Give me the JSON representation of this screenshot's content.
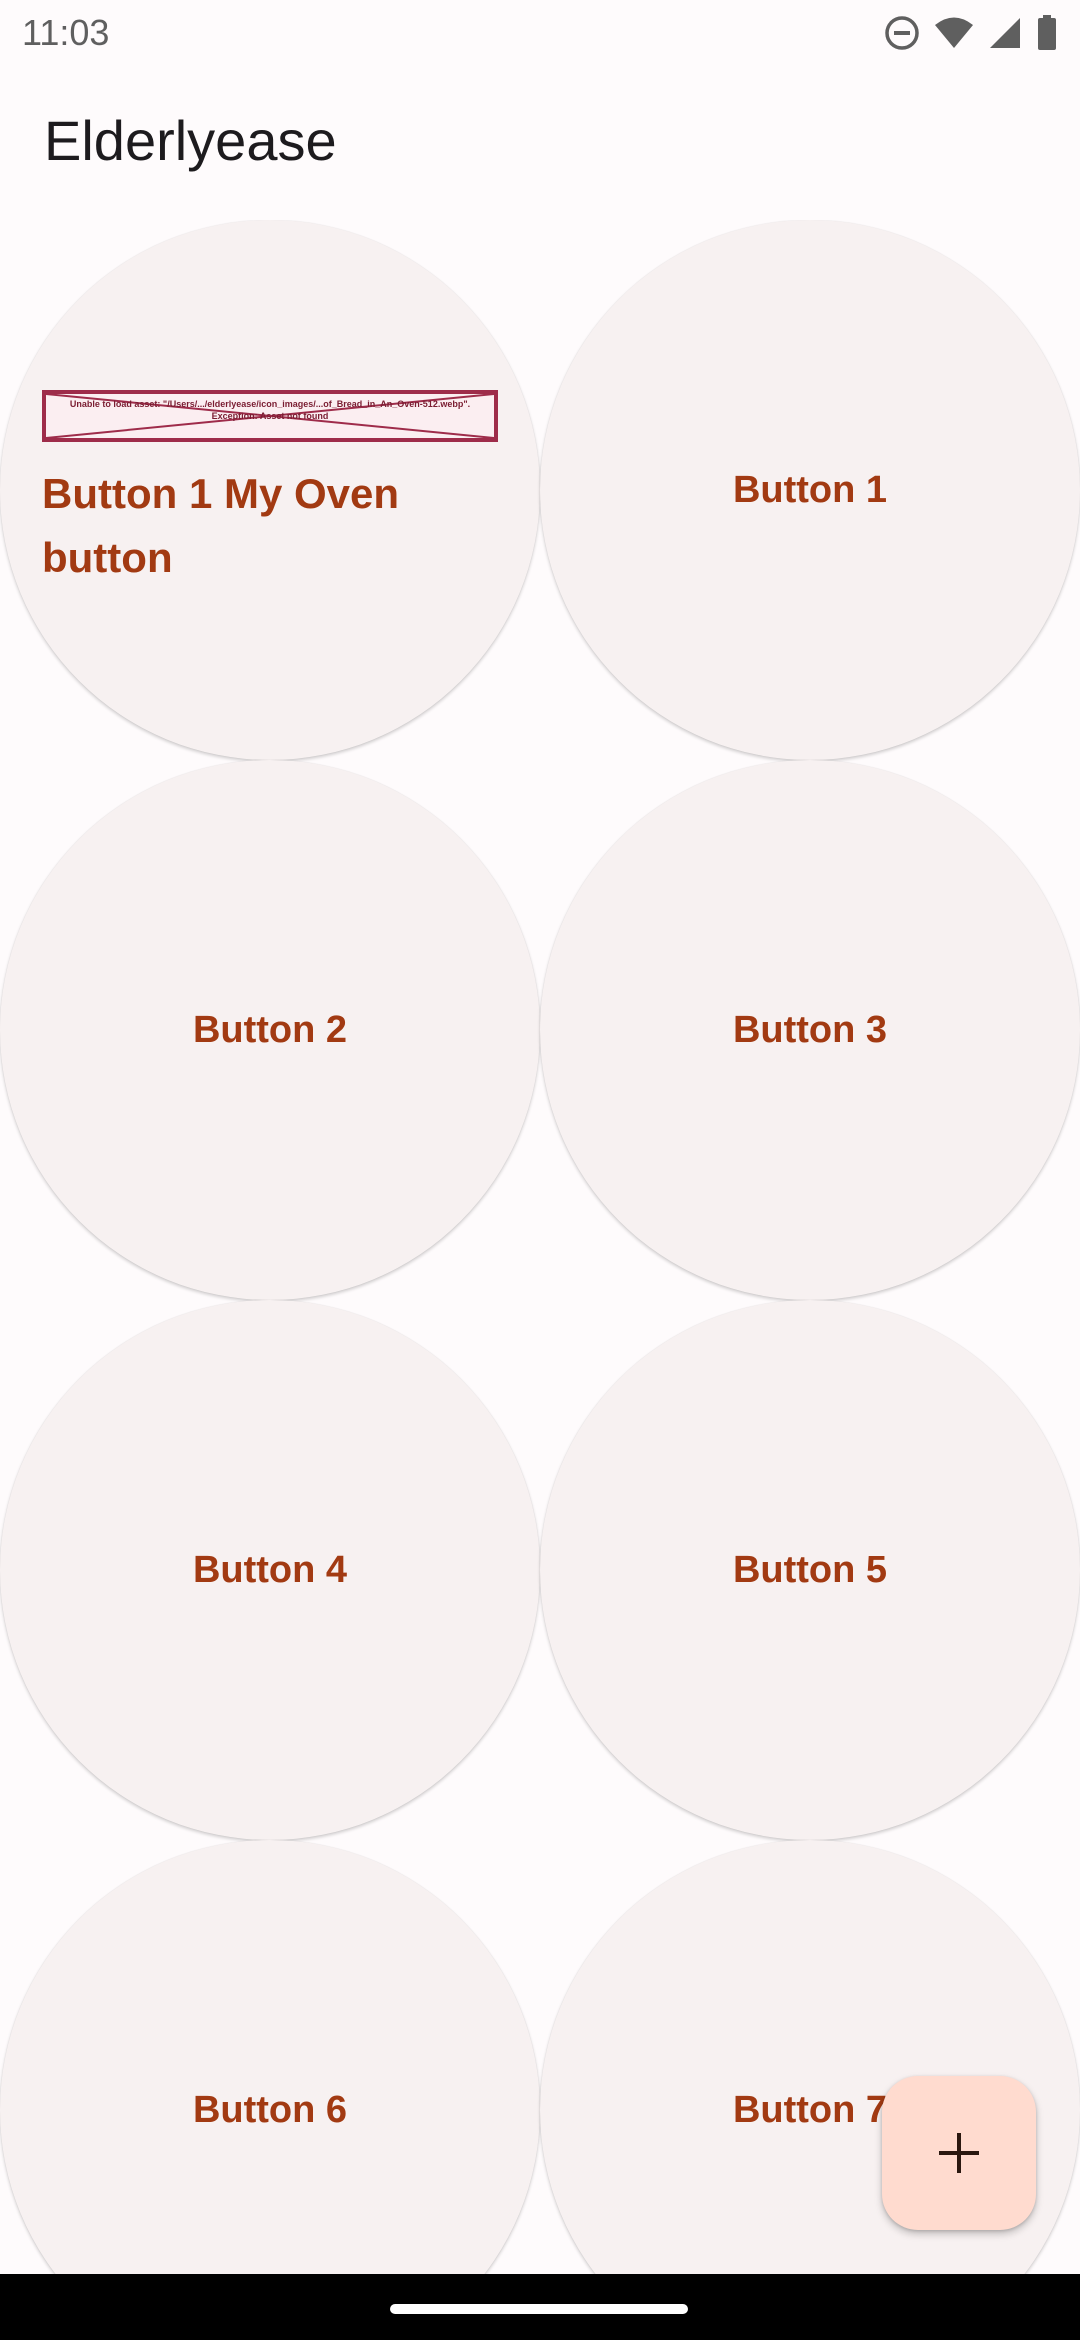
{
  "status_bar": {
    "time": "11:03",
    "icons": [
      "do-not-disturb-icon",
      "wifi-icon",
      "cell-signal-icon",
      "battery-icon"
    ]
  },
  "app_bar": {
    "title": "Elderlyease"
  },
  "buttons": [
    {
      "label": "Button 1 My Oven button",
      "image_error": "Unable to load asset: \"/Users/.../elderlyease/icon_images/...of_Bread_in_An_Oven-512.webp\". Exception: Asset not found"
    },
    {
      "label": "Button 1"
    },
    {
      "label": "Button 2"
    },
    {
      "label": "Button 3"
    },
    {
      "label": "Button 4"
    },
    {
      "label": "Button 5"
    },
    {
      "label": "Button 6"
    },
    {
      "label": "Button 7"
    }
  ],
  "fab": {
    "icon": "plus-icon"
  },
  "colors": {
    "accent_text": "#a23a12",
    "button_bg": "#f7f1f1",
    "fab_bg": "#ffdbcf",
    "background": "#fefbfc"
  }
}
